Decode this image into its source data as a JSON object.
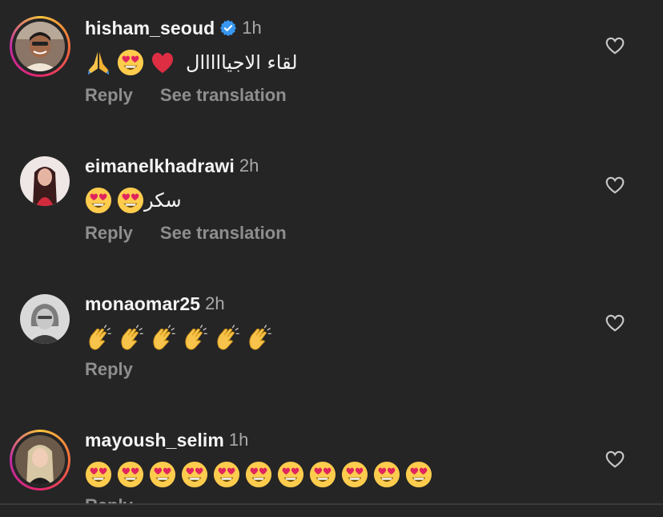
{
  "comments": [
    {
      "username": "hisham_seoud",
      "verified": true,
      "time": "1h",
      "text": "لقاء الاجيااااال",
      "emoji_icons": [
        "red-heart-emoji",
        "heart-eyes-emoji",
        "folded-hands-emoji"
      ],
      "reply_label": "Reply",
      "translate_label": "See translation"
    },
    {
      "username": "eimanelkhadrawi",
      "verified": false,
      "time": "2h",
      "text": "سكر",
      "emoji_icons": [
        "heart-eyes-emoji",
        "heart-eyes-emoji"
      ],
      "reply_label": "Reply",
      "translate_label": "See translation"
    },
    {
      "username": "monaomar25",
      "verified": false,
      "time": "2h",
      "emoji_icons": [
        "clapping-hands-emoji",
        "clapping-hands-emoji",
        "clapping-hands-emoji",
        "clapping-hands-emoji",
        "clapping-hands-emoji",
        "clapping-hands-emoji"
      ],
      "reply_label": "Reply"
    },
    {
      "username": "mayoush_selim",
      "verified": false,
      "time": "1h",
      "emoji_icons": [
        "heart-eyes-emoji",
        "heart-eyes-emoji",
        "heart-eyes-emoji",
        "heart-eyes-emoji",
        "heart-eyes-emoji",
        "heart-eyes-emoji",
        "heart-eyes-emoji",
        "heart-eyes-emoji",
        "heart-eyes-emoji",
        "heart-eyes-emoji",
        "heart-eyes-emoji"
      ],
      "reply_label": "Reply"
    }
  ],
  "colors": {
    "background": "#252526",
    "username": "#f5f5f5",
    "secondary": "#a9a9a9",
    "action": "#8e8e8e",
    "verified_badge": "#3897f0",
    "story_ring": [
      "#f9c33c",
      "#e4286b",
      "#c32aa3"
    ]
  }
}
